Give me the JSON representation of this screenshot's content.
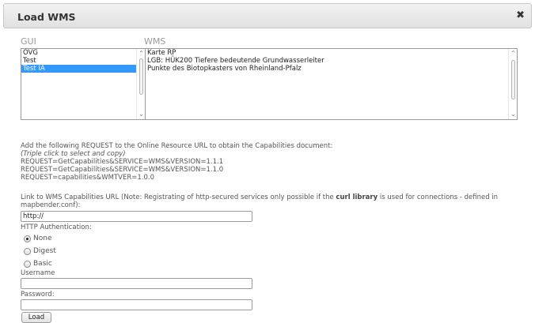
{
  "dialog": {
    "title": "Load WMS",
    "close_glyph": "✖"
  },
  "gui": {
    "label": "GUI",
    "items": [
      "OVG",
      "Test",
      "Test IA"
    ],
    "selected_index": 2
  },
  "wms": {
    "label": "WMS",
    "items": [
      "Karte RP",
      "LGB: HÜK200 Tiefere bedeutende Grundwasserleiter",
      "Punkte des Biotopkasters von Rheinland-Pfalz"
    ]
  },
  "instructions": {
    "line1": "Add the following REQUEST to the Online Resource URL to obtain the Capabilities document:",
    "hint": "(Triple click to select and copy)",
    "req1": "REQUEST=GetCapabilities&SERVICE=WMS&VERSION=1.1.1",
    "req2": "REQUEST=GetCapabilities&SERVICE=WMS&VERSION=1.1.0",
    "req3": "REQUEST=capabilities&WMTVER=1.0.0"
  },
  "link": {
    "prefix": "Link to WMS Capabilities URL (Note: Registrating of http-secured services only possible if the ",
    "bold": "curl library",
    "suffix": " is used for connections - defined in",
    "line2": "mapbender.conf):",
    "value": "http://"
  },
  "auth": {
    "label": "HTTP Authentication:",
    "options": [
      "None",
      "Digest",
      "Basic"
    ],
    "selected": "None"
  },
  "username": {
    "label": "Username",
    "value": ""
  },
  "password": {
    "label": "Password:",
    "value": ""
  },
  "load_button": "Load"
}
